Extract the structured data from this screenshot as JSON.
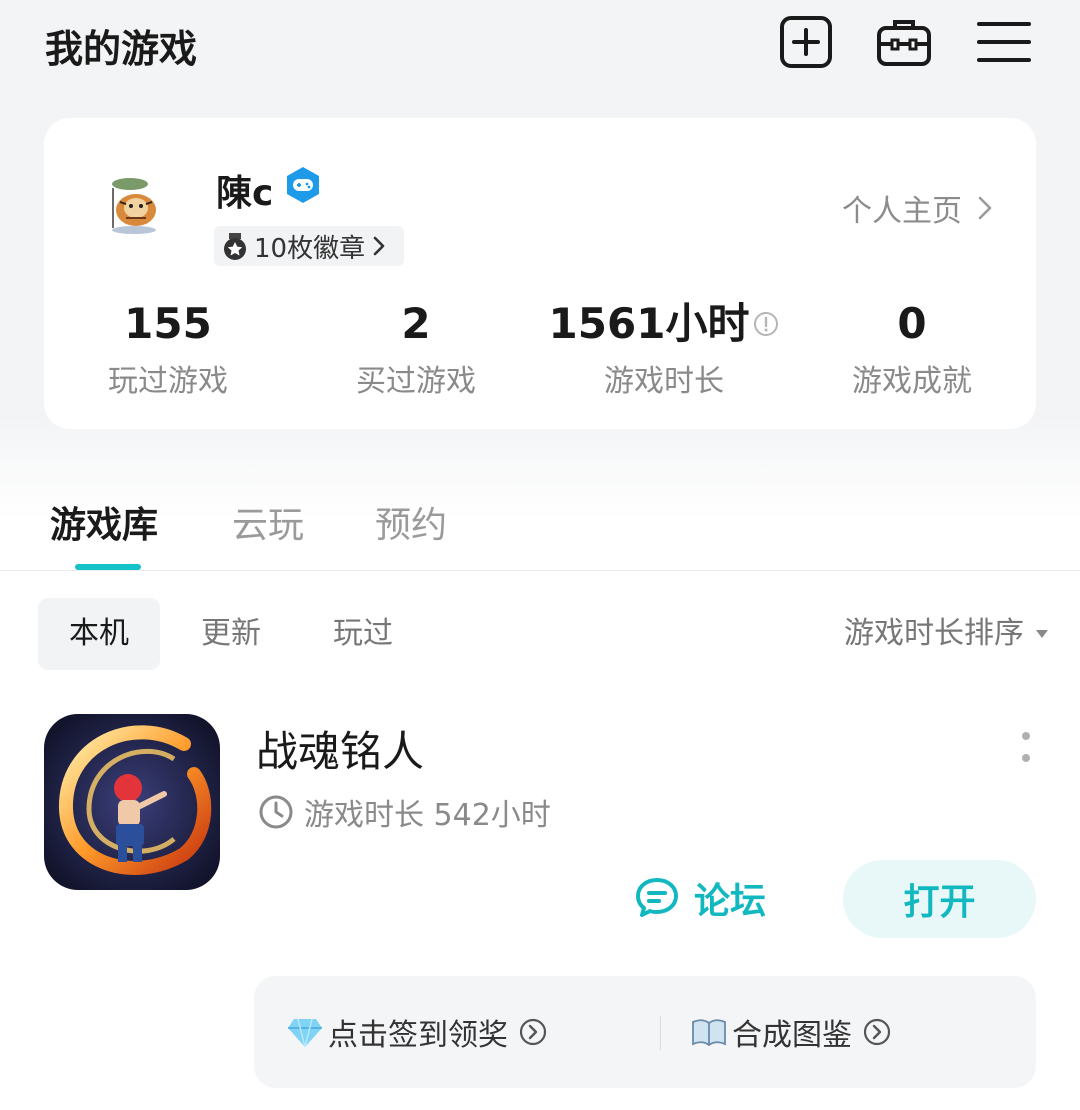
{
  "header": {
    "title": "我的游戏",
    "icons": [
      "add-square-icon",
      "toolbox-icon",
      "menu-icon"
    ]
  },
  "profile": {
    "username": "陳c",
    "verify_icon": "gamepad-verified-icon",
    "badges_label": "10枚徽章",
    "profile_link": "个人主页",
    "stats": [
      {
        "value": "155",
        "label": "玩过游戏"
      },
      {
        "value": "2",
        "label": "买过游戏"
      },
      {
        "value": "1561小时",
        "label": "游戏时长"
      },
      {
        "value": "0",
        "label": "游戏成就"
      }
    ]
  },
  "tabs": [
    {
      "label": "游戏库",
      "active": true
    },
    {
      "label": "云玩",
      "active": false
    },
    {
      "label": "预约",
      "active": false
    }
  ],
  "filters": {
    "chips": [
      {
        "label": "本机",
        "active": true
      },
      {
        "label": "更新",
        "active": false
      },
      {
        "label": "玩过",
        "active": false
      }
    ],
    "sort_label": "游戏时长排序"
  },
  "game": {
    "name": "战魂铭人",
    "playtime": "游戏时长 542小时",
    "forum_label": "论坛",
    "open_label": "打开",
    "quick_actions": [
      {
        "emoji_icon": "diamond-icon",
        "label": "点击签到领奖"
      },
      {
        "emoji_icon": "book-icon",
        "label": "合成图鉴"
      }
    ]
  },
  "colors": {
    "accent": "#14c3c9",
    "background": "#f3f4f6",
    "card": "#ffffff"
  }
}
